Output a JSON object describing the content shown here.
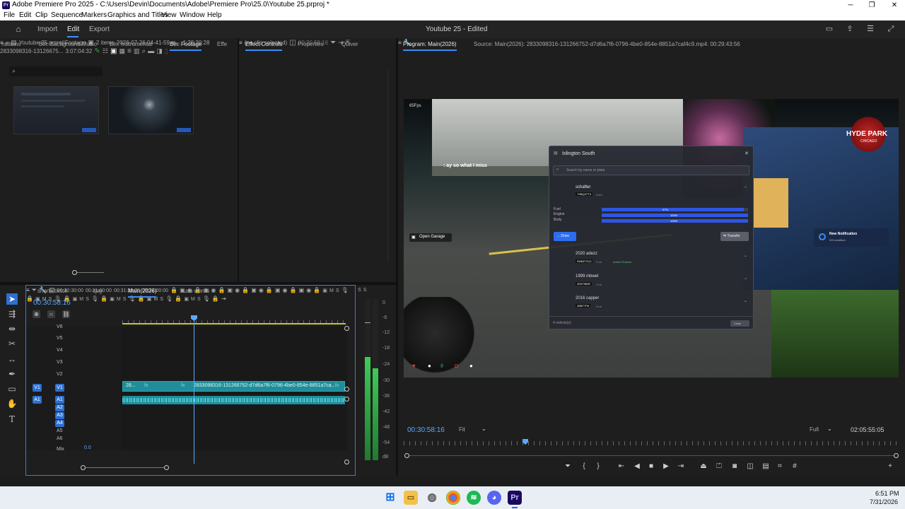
{
  "window": {
    "title": "Adobe Premiere Pro 2025 - C:\\Users\\Devin\\Documents\\Adobe\\Premiere Pro\\25.0\\Youtube 25.prproj *",
    "app_icon_text": "Pr",
    "minimize": "─",
    "maximize": "❐",
    "close": "✕"
  },
  "menu": [
    "File",
    "Edit",
    "Clip",
    "Sequence",
    "Markers",
    "Graphics and Titles",
    "View",
    "Window",
    "Help"
  ],
  "header": {
    "workspaces": [
      "Import",
      "Edit",
      "Export"
    ],
    "active_workspace": "Edit",
    "document_title": "Youtube 25 - Edited"
  },
  "project_panel": {
    "tabs": [
      "nsitions",
      "Bin: Background Music",
      "Bin: Instrumental",
      "Bin: Footage",
      "Effe"
    ],
    "active_tab": "Bin: Footage",
    "path": "Youtube 25.prproj\\Footage",
    "item_count": "2 items",
    "items": [
      {
        "name": "2026-07-26 04-41-59.m...",
        "duration": "1:28:20:28"
      },
      {
        "name": "2833098316-13126675...",
        "duration": "3:07:04:32"
      }
    ]
  },
  "effect_controls": {
    "tabs": [
      "Effect Controls",
      "Properties",
      "Quiver"
    ],
    "active_tab": "Effect Controls",
    "message": "(no clip selected)",
    "timecode": "00:30:58:16"
  },
  "timeline": {
    "tabs": [
      "shorts tiktok",
      "cjay",
      "Main(2026)",
      "cuss words"
    ],
    "active_tab": "Main(2026)",
    "timecode": "00:30:58:16",
    "ruler": [
      "00:30:30:00",
      "00:31:00:00",
      "00:31:30:00",
      "00:32:00:00"
    ],
    "video_tracks": [
      "V6",
      "V5",
      "V4",
      "V3",
      "V2",
      "V1"
    ],
    "audio_tracks": [
      "A1",
      "A2",
      "A3",
      "A4",
      "A5",
      "A6"
    ],
    "mix_label": "Mix",
    "mix_value": "0.0",
    "clip_left_label": "28...",
    "clip_label": "2833098316-131266752-d7d6a7f6-0796-4be0-854e-8851a7ca...",
    "fx": "fx",
    "source_patch_v": "V1",
    "source_patch_a": "A1"
  },
  "audio_meter": {
    "scale": [
      "0",
      "-6",
      "-12",
      "-18",
      "-24",
      "-30",
      "-36",
      "-42",
      "-48",
      "-54",
      "dB"
    ],
    "solo": [
      "S",
      "S"
    ]
  },
  "program_monitor": {
    "program_tab": "Program: Main(2026)",
    "source_text": "Source: Main(2026): 2833098316-131266752-d7d6a7f6-0796-4be0-854e-8851a7caf4c9.mp4: 00:29:43:56",
    "timecode": "00:30:58:16",
    "fit": "Fit",
    "quality": "Full",
    "duration": "02:05:55:05"
  },
  "game_overlay": {
    "fps": "65Fps",
    "chat_name": "",
    "chat_text": ": ay so what I miss",
    "open_garage": "Open Garage",
    "garage_title": "Islington South",
    "search_placeholder": "Search by name or plate",
    "vehicles": [
      {
        "name": "schafter",
        "plate": "7SBQ3TT3",
        "mileage": "0 km"
      },
      {
        "name": "2020 adezz",
        "plate": "9WBZ7S13",
        "mileage": "4 mi",
        "badge": "Active Finance"
      },
      {
        "name": "1999 mbwel",
        "plate": "2R0T9B0F",
        "mileage": "1 mi"
      },
      {
        "name": "2016 capper",
        "plate": "2BBT7PA",
        "mileage": "0 mi"
      }
    ],
    "stats": [
      {
        "label": "Fuel",
        "value": "97%",
        "level": 0.97
      },
      {
        "label": "Engine",
        "value": "100%",
        "level": 1.0
      },
      {
        "label": "Body",
        "value": "100%",
        "level": 1.0
      }
    ],
    "drive": "→ Drive",
    "transfer": "⇆ Transfer",
    "vehicle_count": "4 vehicle(s)",
    "close_label": "Close",
    "notification_title": "New Notification",
    "notification_text": "0/5 condition",
    "logo_main": "HYDE PARK",
    "logo_sub": "CHICAGO"
  },
  "taskbar": {
    "time": "6:51 PM",
    "date": "7/31/2026",
    "premiere_label": "Pr"
  },
  "colors": {
    "accent": "#2d8ceb",
    "clip": "#1f8e9a",
    "timecode": "#5aa9ff",
    "meter": "#2fb24a"
  }
}
